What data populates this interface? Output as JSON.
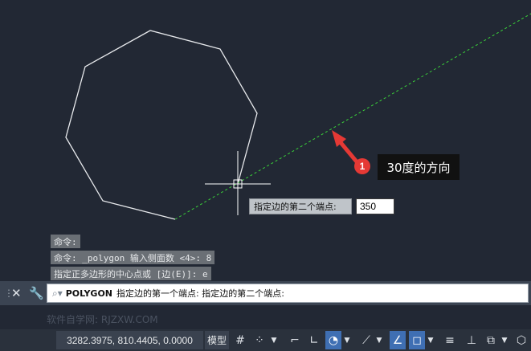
{
  "annotation": {
    "badge": "1",
    "label": "30度的方向"
  },
  "tooltip": {
    "prompt": "指定边的第二个端点:",
    "value": "350"
  },
  "history": [
    "命令:",
    "命令: _polygon 输入侧面数 <4>: 8",
    "指定正多边形的中心点或 [边(E)]: e"
  ],
  "command_line": {
    "keyword": "POLYGON",
    "text": "指定边的第一个端点: 指定边的第二个端点:"
  },
  "watermark": "软件自学网: RJZXW.COM",
  "statusbar": {
    "coordinates": "3282.3975, 810.4405, 0.0000",
    "model": "模型"
  },
  "icons": {
    "cmd_grip": "grip-icon",
    "cmd_close": "close-icon",
    "cmd_customize": "wrench-icon",
    "cmd_prefix": "command-prompt-icon",
    "grid": "grid-icon",
    "snap": "snap-icon",
    "infer": "infer-constraints-icon",
    "ortho": "ortho-icon",
    "polar": "polar-tracking-icon",
    "isodraft": "isodraft-icon",
    "object_track": "object-snap-tracking-icon",
    "osnap": "object-snap-icon",
    "lineweight": "lineweight-icon",
    "dynucs": "dynamic-ucs-icon",
    "selection_cycling": "selection-cycling-icon",
    "gizmo": "3d-gizmo-icon"
  },
  "colors": {
    "canvas": "#222834",
    "polygon": "#e8eaed",
    "tracking_line": "#3ad13a",
    "annotation": "#e53935",
    "active_toggle": "#3f6fb3"
  }
}
